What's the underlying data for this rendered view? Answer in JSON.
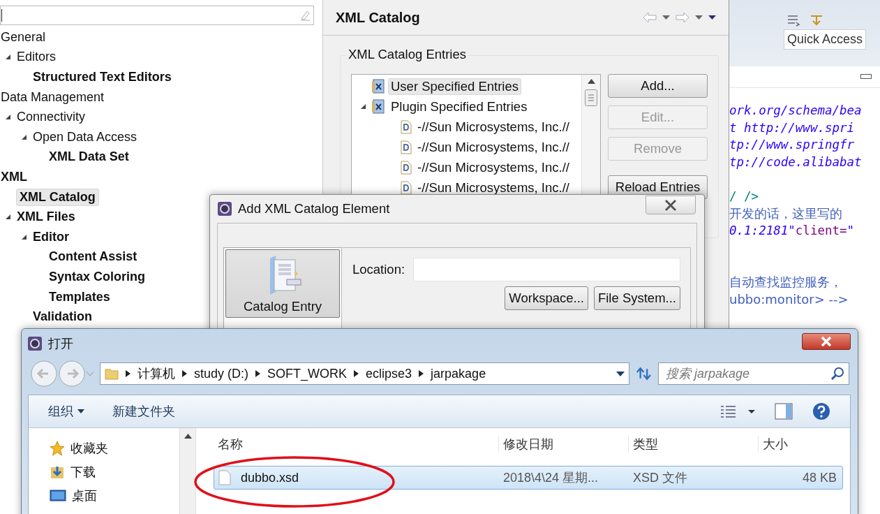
{
  "preferences": {
    "tree": [
      {
        "label": "General",
        "bold": false,
        "selected": false,
        "children": [
          {
            "label": "Editors",
            "bold": false,
            "selected": false,
            "expanded": true,
            "children": [
              {
                "label": "Structured Text Editors",
                "bold": true,
                "selected": false
              }
            ]
          }
        ]
      },
      {
        "label": "Data Management",
        "bold": false,
        "selected": false,
        "children": [
          {
            "label": "Connectivity",
            "bold": false,
            "selected": false,
            "expanded": true,
            "children": [
              {
                "label": "Open Data Access",
                "bold": false,
                "selected": false,
                "expanded": true,
                "children": [
                  {
                    "label": "XML Data Set",
                    "bold": true,
                    "selected": false
                  }
                ]
              }
            ]
          }
        ]
      },
      {
        "label": "XML",
        "bold": true,
        "selected": false,
        "children": [
          {
            "label": "XML Catalog",
            "bold": true,
            "selected": true
          },
          {
            "label": "XML Files",
            "bold": true,
            "selected": false,
            "expanded": true,
            "children": [
              {
                "label": "Editor",
                "bold": true,
                "selected": false,
                "expanded": true,
                "children": [
                  {
                    "label": "Content Assist",
                    "bold": true,
                    "selected": false
                  },
                  {
                    "label": "Syntax Coloring",
                    "bold": true,
                    "selected": false
                  },
                  {
                    "label": "Templates",
                    "bold": true,
                    "selected": false
                  }
                ]
              },
              {
                "label": "Validation",
                "bold": true,
                "selected": false
              }
            ]
          }
        ]
      }
    ]
  },
  "catalog_page": {
    "title": "XML Catalog",
    "group_label": "XML Catalog Entries",
    "entries": [
      {
        "label": "User Specified Entries",
        "kind": "catalog",
        "selected": true
      },
      {
        "label": "Plugin Specified Entries",
        "kind": "catalog",
        "selected": false,
        "expanded": true,
        "children": [
          {
            "label": "-//Sun Microsystems, Inc.//",
            "kind": "dtd",
            "selected": false
          },
          {
            "label": "-//Sun Microsystems, Inc.//",
            "kind": "dtd",
            "selected": false
          },
          {
            "label": "-//Sun Microsystems, Inc.//",
            "kind": "dtd",
            "selected": false
          },
          {
            "label": "-//Sun Microsystems, Inc.//",
            "kind": "dtd",
            "selected": false
          }
        ]
      }
    ],
    "buttons": [
      {
        "label": "Add...",
        "disabled": false
      },
      {
        "label": "Edit...",
        "disabled": true
      },
      {
        "label": "Remove",
        "disabled": true
      },
      {
        "label": "Reload Entries",
        "disabled": false
      }
    ]
  },
  "editor": {
    "quick_access": "Quick Access",
    "lines": [
      {
        "kind": "code",
        "segments": [
          {
            "text": "ork.org/schema/bea",
            "kind": "string"
          }
        ]
      },
      {
        "kind": "code",
        "segments": [
          {
            "text": "t http://www.spri",
            "kind": "string"
          }
        ]
      },
      {
        "kind": "code",
        "segments": [
          {
            "text": "tp://www.springfr",
            "kind": "string"
          }
        ]
      },
      {
        "kind": "code",
        "segments": [
          {
            "text": "tp://code.alibabat",
            "kind": "string"
          }
        ]
      },
      {
        "kind": "blank"
      },
      {
        "kind": "code",
        "segments": [
          {
            "text": "/ />",
            "kind": "tag"
          }
        ]
      },
      {
        "kind": "code",
        "segments": [
          {
            "text": "开发的话，这里写的",
            "kind": "comment"
          }
        ]
      },
      {
        "kind": "code",
        "segments": [
          {
            "text": "0.1:2181\"",
            "kind": "string"
          },
          {
            "text": " client=",
            "kind": "attr"
          },
          {
            "text": "\"",
            "kind": "string"
          }
        ]
      },
      {
        "kind": "blank"
      },
      {
        "kind": "blank"
      },
      {
        "kind": "code",
        "segments": [
          {
            "text": "自动查找监控服务，",
            "kind": "comment"
          }
        ]
      },
      {
        "kind": "code",
        "segments": [
          {
            "text": "ubbo:monitor> -->",
            "kind": "comment"
          }
        ]
      }
    ]
  },
  "add_dialog": {
    "title": "Add XML Catalog Element",
    "types": [
      {
        "label": "Catalog Entry",
        "selected": true
      }
    ],
    "location_label": "Location:",
    "buttons": [
      "Workspace...",
      "File System..."
    ]
  },
  "open_dialog": {
    "title": "打开",
    "path": [
      "计算机",
      "study (D:)",
      "SOFT_WORK",
      "eclipse3",
      "jarpakage"
    ],
    "search": {
      "placeholder": "搜索 jarpakage"
    },
    "organize": "组织",
    "new_folder": "新建文件夹",
    "sidebar": [
      {
        "label": "收藏夹",
        "kind": "star"
      },
      {
        "label": "下载",
        "kind": "download"
      },
      {
        "label": "桌面",
        "kind": "desktop"
      }
    ],
    "columns": [
      "名称",
      "修改日期",
      "类型",
      "大小"
    ],
    "rows": [
      {
        "cells": [
          "dubbo.xsd",
          "2018\\4\\24 星期...",
          "XSD 文件",
          "48 KB"
        ],
        "selected": true,
        "circled": true
      }
    ]
  }
}
